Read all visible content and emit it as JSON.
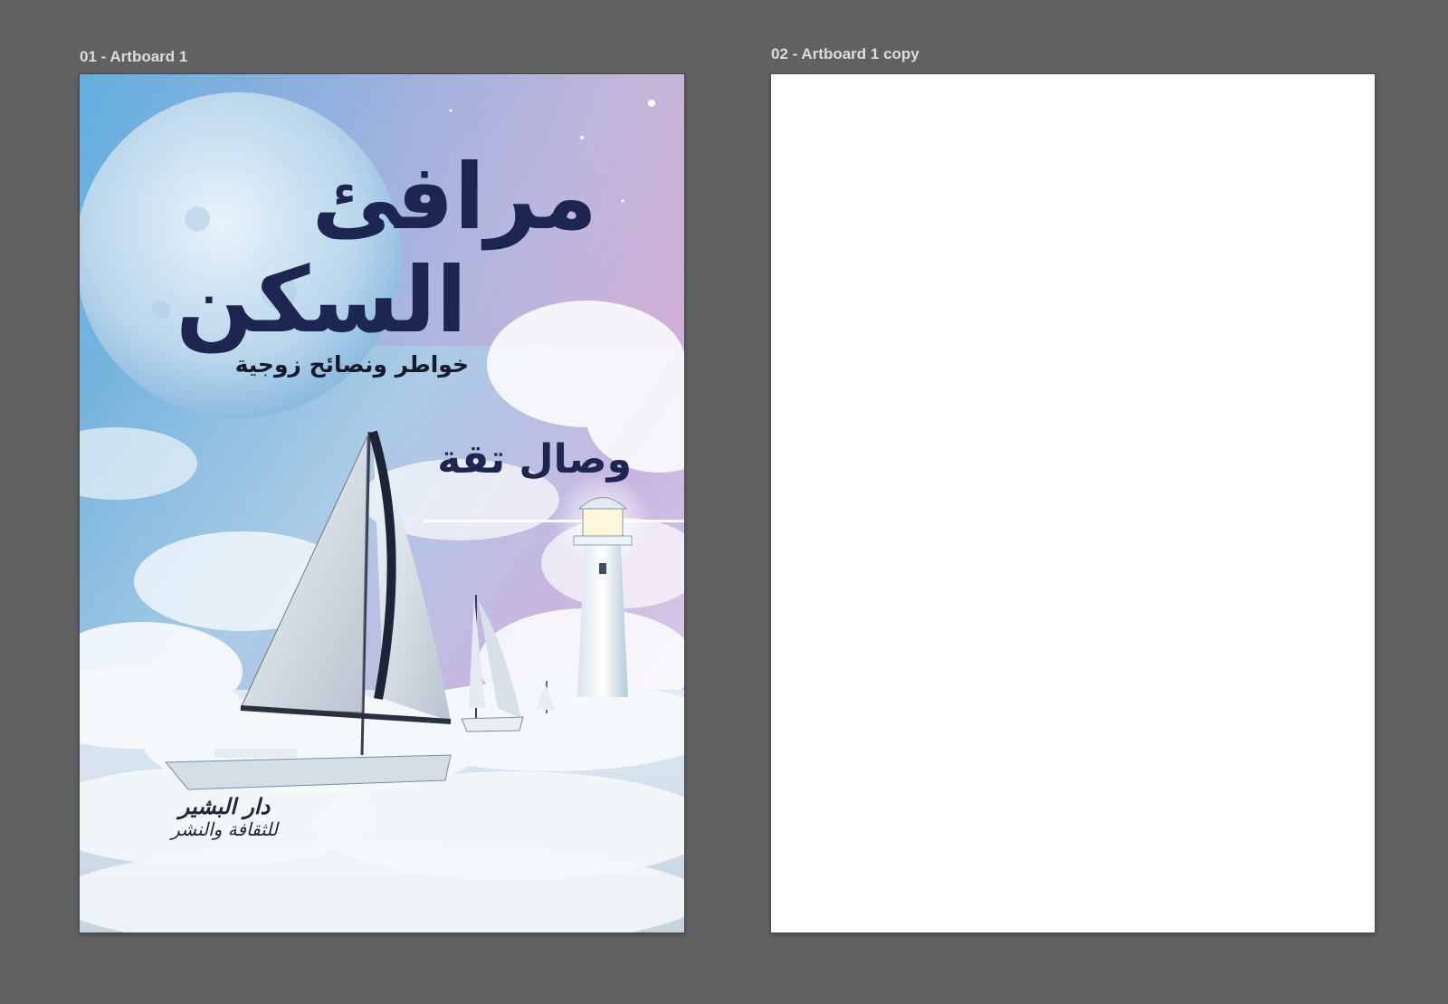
{
  "artboards": [
    {
      "label": "01 - Artboard 1",
      "cover": {
        "title_line1": "مرافئ",
        "title_line2": "السكن",
        "subtitle": "خواطر ونصائح زوجية",
        "author": "وصال تقة",
        "publisher_line1": "دار البشير",
        "publisher_line2": "للثقافة والنشر"
      }
    },
    {
      "label": "02 - Artboard 1 copy",
      "background": "#ffffff"
    }
  ],
  "colors": {
    "canvas_background": "#616161",
    "title_text": "#1c2650"
  }
}
